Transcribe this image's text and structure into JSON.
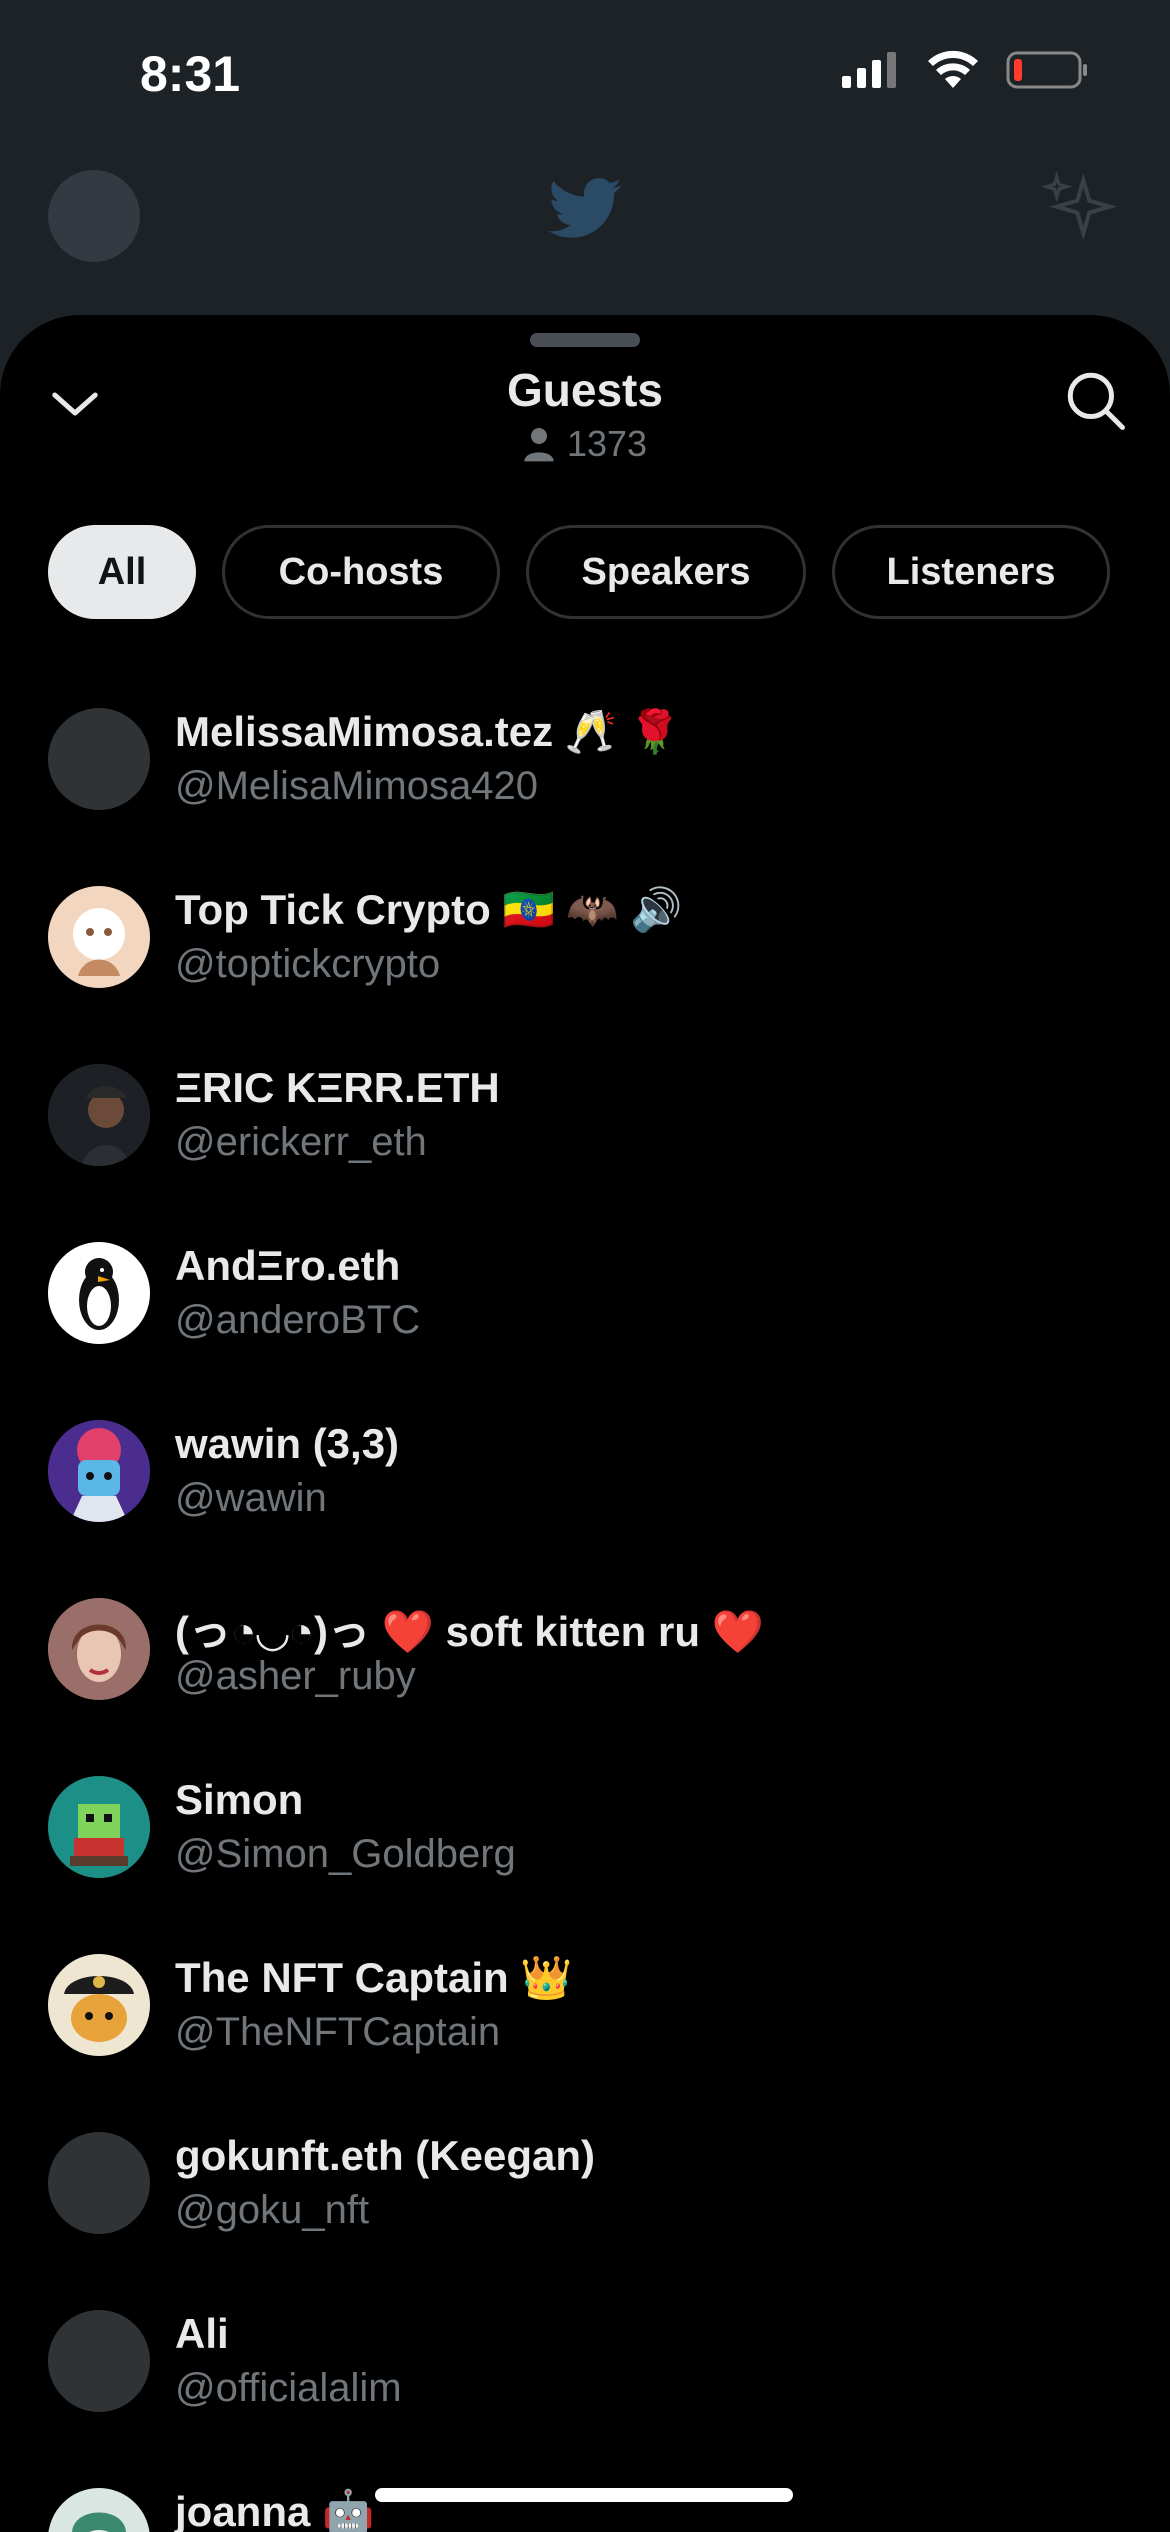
{
  "status": {
    "time": "8:31",
    "icons": [
      "signal-icon",
      "wifi-icon",
      "battery-low-icon"
    ]
  },
  "background_app": {
    "icons": [
      "profile-avatar",
      "twitter-bird-icon",
      "sparkle-icon"
    ]
  },
  "sheet": {
    "title": "Guests",
    "listener_count": "1373",
    "collapse_icon": "chevron-down-icon",
    "search_icon": "search-icon"
  },
  "tabs": [
    {
      "label": "All",
      "active": true
    },
    {
      "label": "Co-hosts",
      "active": false
    },
    {
      "label": "Speakers",
      "active": false
    },
    {
      "label": "Listeners",
      "active": false
    }
  ],
  "guests": [
    {
      "name": "MelissaMimosa.tez 🥂 🌹",
      "handle": "@MelisaMimosa420",
      "avatar_color": "#2f3336"
    },
    {
      "name": "Top Tick Crypto 🇪🇹 🦇 🔊",
      "handle": "@toptickcrypto",
      "avatar_color": "#f3d6bf"
    },
    {
      "name": "ΞRIC KΞRR.ETH",
      "handle": "@erickerr_eth",
      "avatar_color": "#24282c"
    },
    {
      "name": "AndΞro.eth",
      "handle": "@anderoBTC",
      "avatar_color": "#ffffff"
    },
    {
      "name": "wawin (3,3)",
      "handle": "@wawin",
      "avatar_color": "#5b3fa8"
    },
    {
      "name": "(っ◔◡◔)っ ❤️ soft kitten ru ❤️",
      "handle": "@asher_ruby",
      "avatar_color": "#b88a86"
    },
    {
      "name": "Simon",
      "handle": "@Simon_Goldberg",
      "avatar_color": "#1c8f86"
    },
    {
      "name": "The NFT Captain 👑",
      "handle": "@TheNFTCaptain",
      "avatar_color": "#e7a23b"
    },
    {
      "name": "gokunft.eth (Keegan)",
      "handle": "@goku_nft",
      "avatar_color": "#2f3336"
    },
    {
      "name": "Ali",
      "handle": "@officialalim",
      "avatar_color": "#2f3336"
    },
    {
      "name": "joanna 🤖",
      "handle": "",
      "avatar_color": "#d9e6e2"
    }
  ]
}
